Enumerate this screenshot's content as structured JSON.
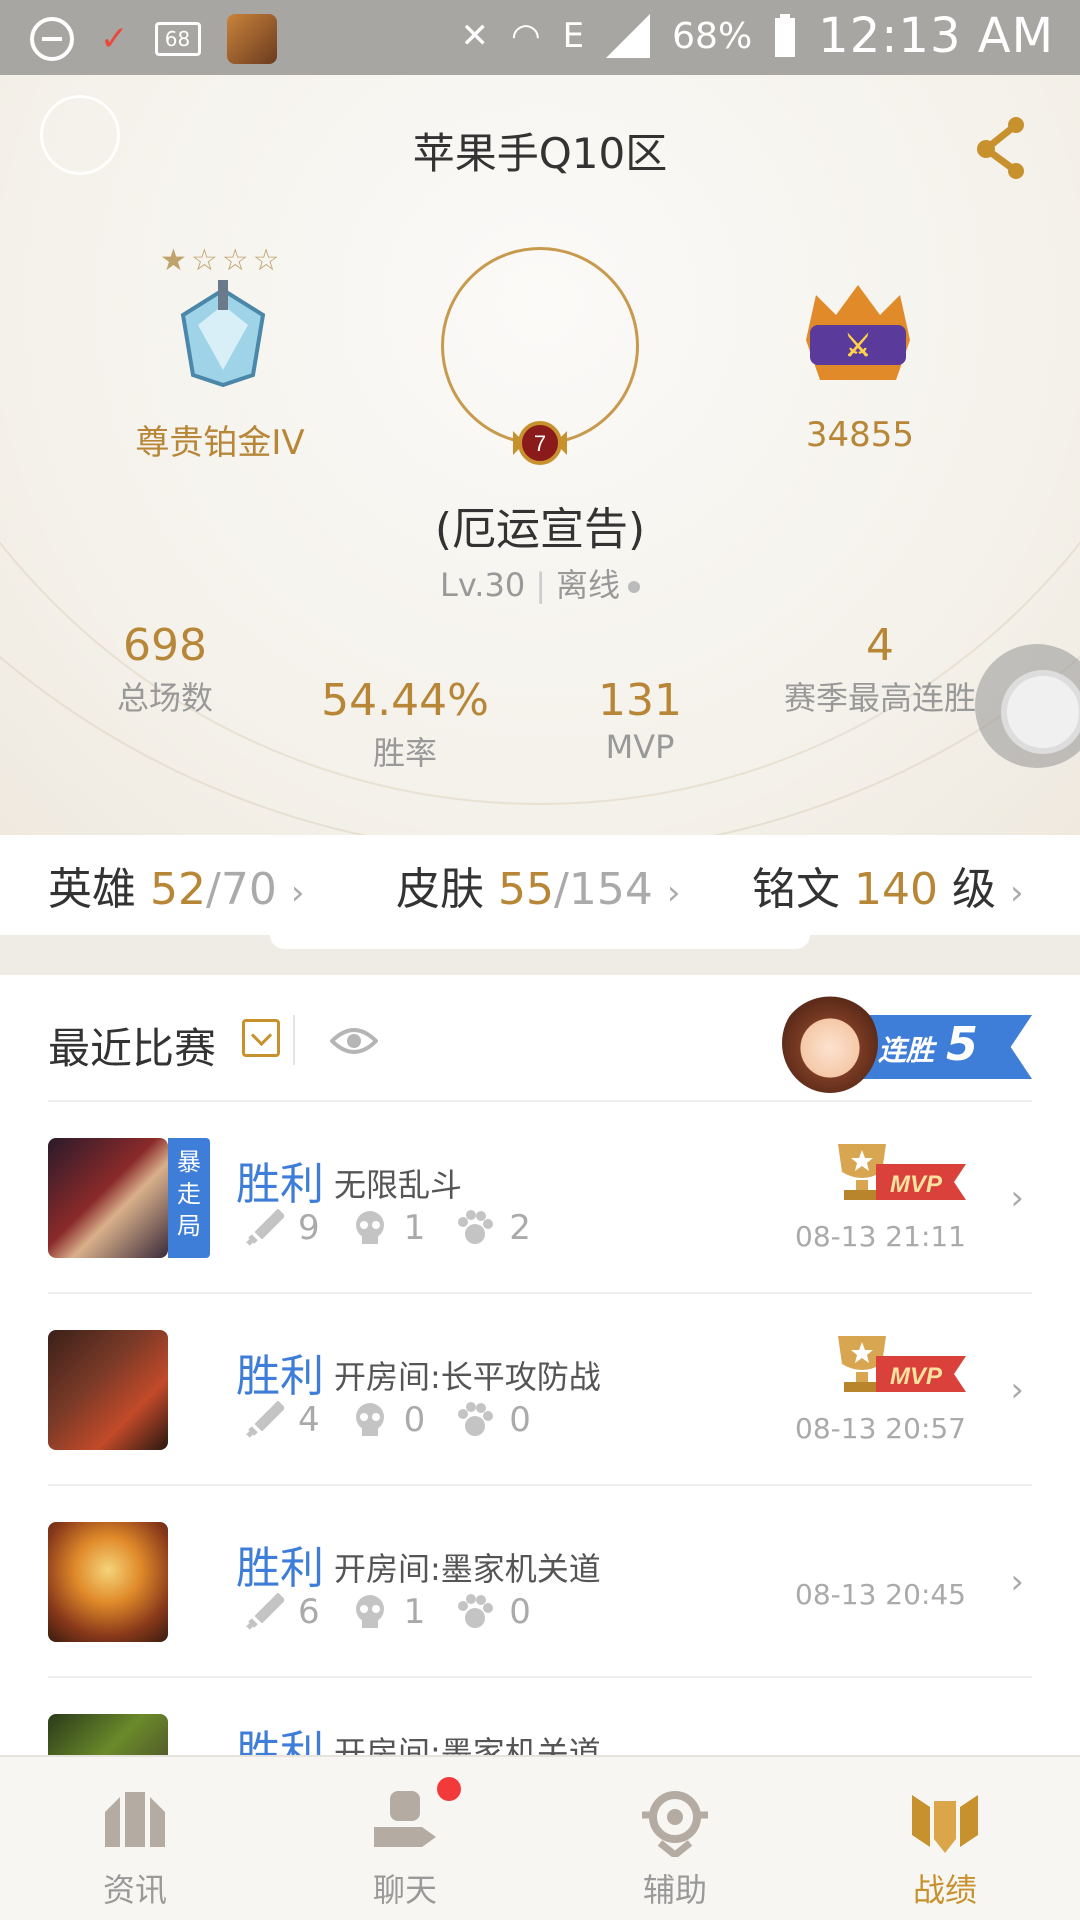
{
  "status_bar": {
    "notif_box": "68",
    "network": "E",
    "battery_pct": "68%",
    "time": "12:13 AM"
  },
  "profile": {
    "region": "苹果手Q10区",
    "rank_name": "尊贵铂金IV",
    "rank_stars": "★☆☆☆",
    "level_badge": "7",
    "player_name": "(厄运宣告)",
    "level": "Lv.30",
    "status": "离线",
    "power": "34855",
    "stats": {
      "total_games": {
        "value": "698",
        "label": "总场数"
      },
      "win_rate": {
        "value": "54.44%",
        "label": "胜率"
      },
      "mvp": {
        "value": "131",
        "label": "MVP"
      },
      "max_streak": {
        "value": "4",
        "label": "赛季最高连胜"
      }
    }
  },
  "collection": {
    "heroes": {
      "label": "英雄",
      "owned": "52",
      "total": "/70"
    },
    "skins": {
      "label": "皮肤",
      "owned": "55",
      "total": "/154"
    },
    "inscription": {
      "label": "铭文",
      "value": "140",
      "unit": "级"
    }
  },
  "recent": {
    "title": "最近比赛",
    "streak_label": "连胜",
    "streak_count": "5",
    "matches": [
      {
        "result": "胜利",
        "mode": "无限乱斗",
        "tag": "暴走局",
        "kills": "9",
        "deaths": "1",
        "assists": "2",
        "mvp": true,
        "time": "08-13 21:11"
      },
      {
        "result": "胜利",
        "mode": "开房间:长平攻防战",
        "tag": "",
        "kills": "4",
        "deaths": "0",
        "assists": "0",
        "mvp": true,
        "time": "08-13 20:57"
      },
      {
        "result": "胜利",
        "mode": "开房间:墨家机关道",
        "tag": "",
        "kills": "6",
        "deaths": "1",
        "assists": "0",
        "mvp": false,
        "time": "08-13 20:45"
      },
      {
        "result": "胜利",
        "mode": "开房间:墨家机关道",
        "tag": "",
        "kills": "",
        "deaths": "",
        "assists": "",
        "mvp": false,
        "time": ""
      }
    ],
    "mvp_label": "MVP"
  },
  "bottom_nav": [
    {
      "label": "资讯",
      "icon": "news-icon"
    },
    {
      "label": "聊天",
      "icon": "chat-icon",
      "badge": true
    },
    {
      "label": "辅助",
      "icon": "assist-icon"
    },
    {
      "label": "战绩",
      "icon": "record-icon",
      "active": true
    }
  ],
  "colors": {
    "gold": "#b78637",
    "blue": "#3f7ed8",
    "badge_red": "#f23a3a"
  }
}
